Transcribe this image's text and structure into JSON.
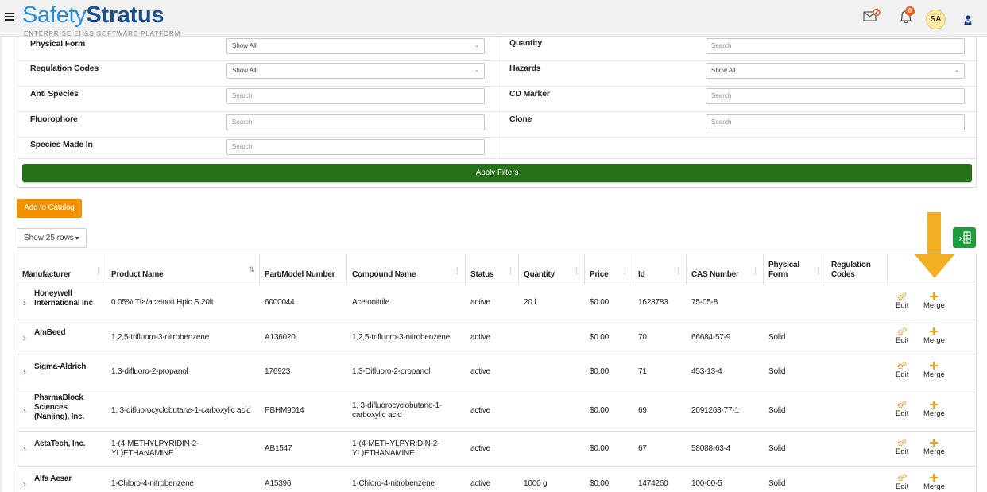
{
  "header": {
    "logo_light": "Safety",
    "logo_bold": "Stratus",
    "logo_subtitle": "ENTERPRISE EH&S SOFTWARE PLATFORM",
    "notification_count": "0",
    "avatar_initials": "SA"
  },
  "filters": {
    "left": [
      {
        "label": "Physical Form",
        "type": "select",
        "value": "Show All"
      },
      {
        "label": "Regulation Codes",
        "type": "select",
        "value": "Show All"
      },
      {
        "label": "Anti Species",
        "type": "search",
        "value": "Search"
      },
      {
        "label": "Fluorophore",
        "type": "search",
        "value": "Search"
      },
      {
        "label": "Species Made In",
        "type": "search",
        "value": "Search"
      }
    ],
    "right": [
      {
        "label": "Quantity",
        "type": "search",
        "value": "Search"
      },
      {
        "label": "Hazards",
        "type": "select",
        "value": "Show All"
      },
      {
        "label": "CD Marker",
        "type": "search",
        "value": "Search"
      },
      {
        "label": "Clone",
        "type": "search",
        "value": "Search"
      }
    ],
    "apply_label": "Apply Filters"
  },
  "actions": {
    "add_to_catalog_label": "Add to Catalog",
    "rows_select_label": "Show 25 rows"
  },
  "table": {
    "columns": [
      {
        "label": "Manufacturer"
      },
      {
        "label": "Product Name"
      },
      {
        "label": "Part/Model Number"
      },
      {
        "label": "Compound Name"
      },
      {
        "label": "Status"
      },
      {
        "label": "Quantity"
      },
      {
        "label": "Price"
      },
      {
        "label": "Id"
      },
      {
        "label": "CAS Number"
      },
      {
        "label": "Physical Form"
      },
      {
        "label": "Regulation Codes"
      },
      {
        "label": ""
      }
    ],
    "edit_label": "Edit",
    "merge_label": "Merge",
    "rows": [
      {
        "manufacturer": "Honeywell International Inc",
        "product_name": "0.05% Tfa/acetonit Hplc S 20lt",
        "part_number": "6000044",
        "compound_name": "Acetonitrile",
        "status": "active",
        "quantity": "20 l",
        "price": "$0.00",
        "id": "1628783",
        "cas_number": "75-05-8",
        "physical_form": "",
        "regulation_codes": ""
      },
      {
        "manufacturer": "AmBeed",
        "product_name": "1,2,5-trifluoro-3-nitrobenzene",
        "part_number": "A136020",
        "compound_name": "1,2,5-trifluoro-3-nitrobenzene",
        "status": "active",
        "quantity": "",
        "price": "$0.00",
        "id": "70",
        "cas_number": "66684-57-9",
        "physical_form": "Solid",
        "regulation_codes": ""
      },
      {
        "manufacturer": "Sigma-Aldrich",
        "product_name": "1,3-difluoro-2-propanol",
        "part_number": "176923",
        "compound_name": "1,3-Difluoro-2-propanol",
        "status": "active",
        "quantity": "",
        "price": "$0.00",
        "id": "71",
        "cas_number": "453-13-4",
        "physical_form": "Solid",
        "regulation_codes": ""
      },
      {
        "manufacturer": "PharmaBlock Sciences (Nanjing), Inc.",
        "product_name": "1, 3-difluorocyclobutane-1-carboxylic acid",
        "part_number": "PBHM9014",
        "compound_name": "1, 3-difluorocyclobutane-1-carboxylic acid",
        "status": "active",
        "quantity": "",
        "price": "$0.00",
        "id": "69",
        "cas_number": "2091263-77-1",
        "physical_form": "Solid",
        "regulation_codes": ""
      },
      {
        "manufacturer": "AstaTech, Inc.",
        "product_name": "1-(4-METHYLPYRIDIN-2-YL)ETHANAMINE",
        "part_number": "AB1547",
        "compound_name": "1-(4-METHYLPYRIDIN-2-YL)ETHANAMINE",
        "status": "active",
        "quantity": "",
        "price": "$0.00",
        "id": "67",
        "cas_number": "58088-63-4",
        "physical_form": "Solid",
        "regulation_codes": ""
      },
      {
        "manufacturer": "Alfa Aesar",
        "product_name": "1-Chloro-4-nitrobenzene",
        "part_number": "A15396",
        "compound_name": "1-Chloro-4-nitrobenzene",
        "status": "active",
        "quantity": "1000 g",
        "price": "$0.00",
        "id": "1474260",
        "cas_number": "100-00-5",
        "physical_form": "Solid",
        "regulation_codes": ""
      }
    ]
  },
  "colors": {
    "brand_blue": "#2a8fd6",
    "brand_navy": "#1a4f8e",
    "apply_green": "#257018",
    "catalog_orange": "#f29100",
    "excel_green": "#1e9b3b",
    "annotation_arrow": "#f2b022"
  }
}
